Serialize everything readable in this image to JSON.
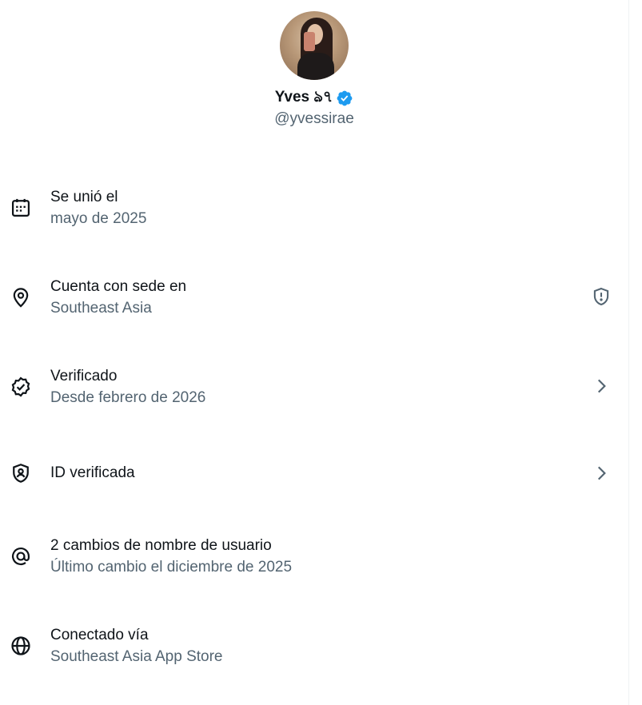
{
  "profile": {
    "name": "Yves ঌ৭",
    "handle": "@yvessirae",
    "verified_badge_color": "#1d9bf0"
  },
  "about_rows": [
    {
      "icon": "calendar-icon",
      "title": "Se unió el",
      "subtitle": "mayo de 2025",
      "trailing": ""
    },
    {
      "icon": "location-pin-icon",
      "title": "Cuenta con sede en",
      "subtitle": "Southeast Asia",
      "trailing": "shield-alert-icon"
    },
    {
      "icon": "verified-badge-outline-icon",
      "title": "Verificado",
      "subtitle": "Desde febrero de 2026",
      "trailing": "chevron-right-icon"
    },
    {
      "icon": "id-shield-icon",
      "title": "ID verificada",
      "subtitle": "",
      "trailing": "chevron-right-icon"
    },
    {
      "icon": "at-sign-icon",
      "title": "2 cambios de nombre de usuario",
      "subtitle": "Último cambio el diciembre de 2025",
      "trailing": ""
    },
    {
      "icon": "globe-icon",
      "title": "Conectado vía",
      "subtitle": "Southeast Asia App Store",
      "trailing": ""
    }
  ],
  "colors": {
    "primary_text": "#0f1419",
    "secondary_text": "#536471",
    "accent": "#1d9bf0"
  }
}
